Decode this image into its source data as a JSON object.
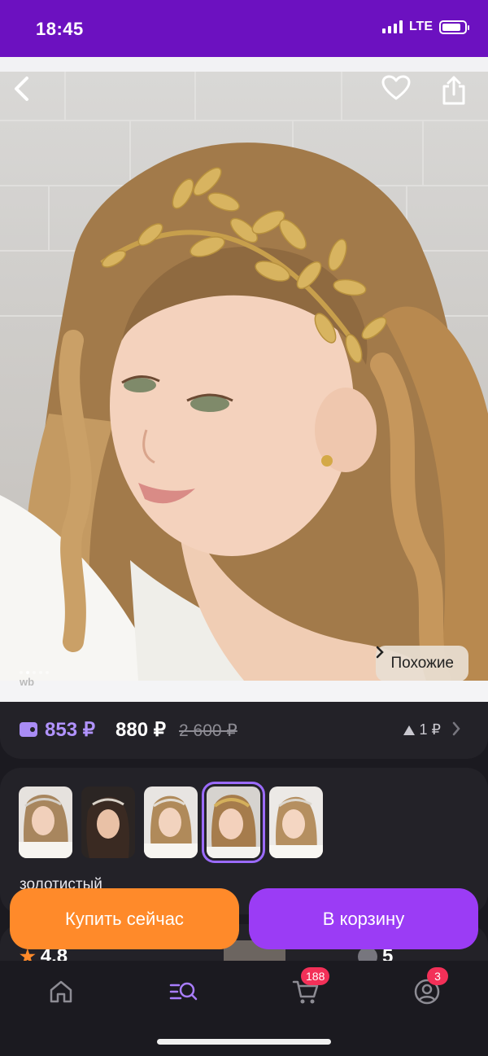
{
  "status_bar": {
    "time": "18:45",
    "network": "LTE",
    "battery_level": 0.85
  },
  "hero": {
    "back_icon": "chevron-left-icon",
    "favorite_icon": "heart-icon",
    "share_icon": "share-icon",
    "similar_label": "Похожие",
    "image_count": 5,
    "active_image": 1,
    "watermark": "wb"
  },
  "price": {
    "wallet_price": "853 ₽",
    "price": "880 ₽",
    "old_price": "2 600 ₽",
    "delta": "1 ₽"
  },
  "variants": {
    "items": [
      "variant-1",
      "variant-2",
      "variant-3",
      "variant-4",
      "variant-5"
    ],
    "selected_index": 3,
    "color_label": "золотистый"
  },
  "peek": {
    "rating": "4.8",
    "questions": "5"
  },
  "actions": {
    "buy_now": "Купить сейчас",
    "add_to_cart": "В корзину"
  },
  "bottom_nav": {
    "items": [
      {
        "name": "home",
        "icon": "home-icon"
      },
      {
        "name": "catalog",
        "icon": "search-catalog-icon",
        "active": true
      },
      {
        "name": "cart",
        "icon": "cart-icon",
        "badge": "188"
      },
      {
        "name": "profile",
        "icon": "profile-icon",
        "badge": "3"
      }
    ]
  },
  "colors": {
    "brand": "#6c11c0",
    "buy": "#ff8a2a",
    "cart": "#9b3cf5",
    "wallet_price": "#b193ff",
    "badge": "#f33058"
  }
}
